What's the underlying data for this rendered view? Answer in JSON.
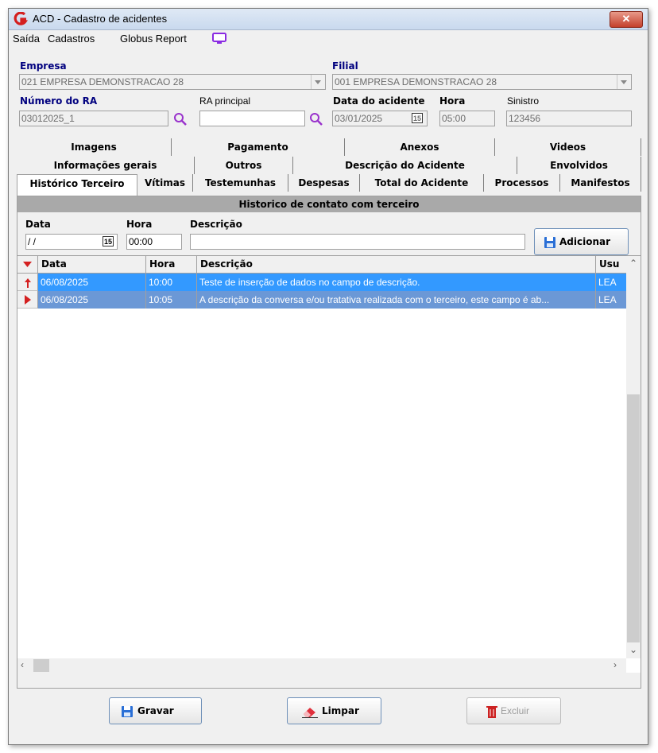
{
  "window": {
    "title": "ACD - Cadastro de acidentes",
    "close_label": "✕"
  },
  "menu": {
    "items": [
      "Saída",
      "Cadastros",
      "Globus Report"
    ]
  },
  "form": {
    "empresa_label": "Empresa",
    "empresa_value": "021 EMPRESA DEMONSTRACAO 28",
    "filial_label": "Filial",
    "filial_value": "001 EMPRESA DEMONSTRACAO 28",
    "numero_ra_label": "Número do RA",
    "numero_ra_value": "03012025_1",
    "ra_principal_label": "RA principal",
    "ra_principal_value": "",
    "data_acidente_label": "Data do acidente",
    "data_acidente_value": "03/01/2025",
    "hora_label": "Hora",
    "hora_value": "05:00",
    "sinistro_label": "Sinistro",
    "sinistro_value": "123456",
    "calendar_glyph": "15"
  },
  "tabs": {
    "row1": [
      "Imagens",
      "Pagamento",
      "Anexos",
      "Videos"
    ],
    "row2": [
      "Informações gerais",
      "Outros",
      "Descrição do Acidente",
      "Envolvidos"
    ],
    "row3": [
      "Histórico Terceiro",
      "Vítimas",
      "Testemunhas",
      "Despesas",
      "Total do Acidente",
      "Processos",
      "Manifestos"
    ]
  },
  "historico": {
    "header": "Historico de contato com terceiro",
    "data_label": "Data",
    "data_value": "/ /",
    "hora_label": "Hora",
    "hora_value": "00:00",
    "descricao_label": "Descrição",
    "descricao_value": "",
    "add_button": "Adicionar"
  },
  "grid": {
    "columns": [
      "Data",
      "Hora",
      "Descrição",
      "Usu"
    ],
    "rows": [
      {
        "data": "06/08/2025",
        "hora": "10:00",
        "descricao": "Teste de inserção de dados no campo de descrição.",
        "usuario": "LEA"
      },
      {
        "data": "06/08/2025",
        "hora": "10:05",
        "descricao": "A descrição da conversa e/ou tratativa realizada com o terceiro, este campo é ab...",
        "usuario": "LEA"
      }
    ]
  },
  "footer": {
    "save": "Gravar",
    "clear": "Limpar",
    "delete": "Excluir"
  },
  "colors": {
    "selection": "#3399ff",
    "selection_inactive": "#6b98d6",
    "accent_red": "#cc2222",
    "label_blue": "#00007f"
  }
}
